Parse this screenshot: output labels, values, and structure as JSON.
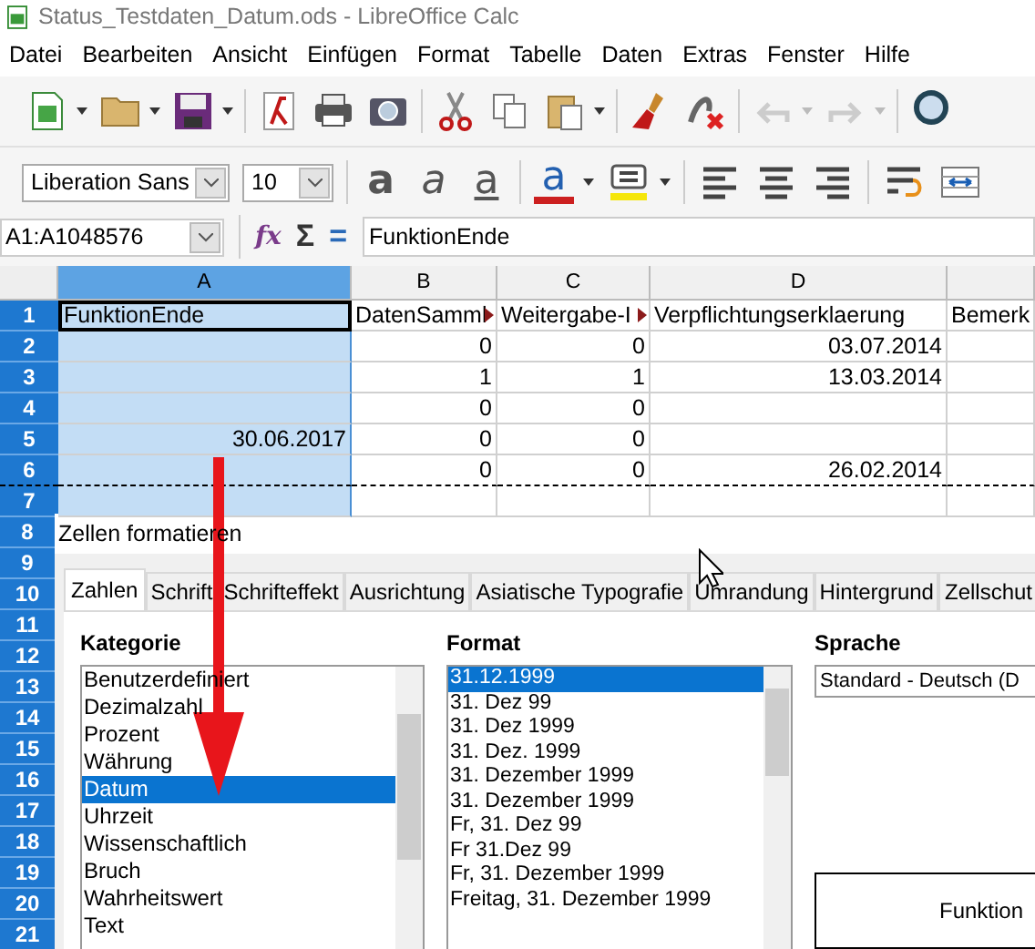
{
  "window": {
    "title": "Status_Testdaten_Datum.ods - LibreOffice Calc"
  },
  "menu": [
    "Datei",
    "Bearbeiten",
    "Ansicht",
    "Einfügen",
    "Format",
    "Tabelle",
    "Daten",
    "Extras",
    "Fenster",
    "Hilfe"
  ],
  "format_toolbar": {
    "font": "Liberation Sans",
    "size": "10",
    "glyphs": [
      {
        "kind": "bold",
        "glyph": "a"
      },
      {
        "kind": "italic",
        "glyph": "a"
      },
      {
        "kind": "underline",
        "glyph": "a"
      },
      {
        "kind": "font_color",
        "glyph": "a"
      }
    ]
  },
  "formula_bar": {
    "name_box": "A1:A1048576",
    "function_glyph": "fx",
    "sum_glyph": "Σ",
    "equals_glyph": "=",
    "content": "FunktionEnde"
  },
  "sheet": {
    "columns": [
      {
        "label": "A",
        "selected": true
      },
      {
        "label": "B",
        "selected": false
      },
      {
        "label": "C",
        "selected": false
      },
      {
        "label": "D",
        "selected": false
      }
    ],
    "rows": [
      {
        "label": "1",
        "kind": "text",
        "page_break": false,
        "cells": [
          "FunktionEnde",
          "DatenSamml",
          "Weitergabe-I",
          "Verpflichtungserklaerung",
          "Bemerk"
        ],
        "overflow": [
          false,
          true,
          true,
          false,
          false
        ]
      },
      {
        "label": "2",
        "kind": "number",
        "page_break": false,
        "cells": [
          null,
          "0",
          "0",
          "03.07.2014",
          null
        ],
        "overflow": [
          false,
          false,
          false,
          false,
          false
        ]
      },
      {
        "label": "3",
        "kind": "number",
        "page_break": false,
        "cells": [
          null,
          "1",
          "1",
          "13.03.2014",
          null
        ],
        "overflow": [
          false,
          false,
          false,
          false,
          false
        ]
      },
      {
        "label": "4",
        "kind": "number",
        "page_break": false,
        "cells": [
          null,
          "0",
          "0",
          null,
          null
        ],
        "overflow": [
          false,
          false,
          false,
          false,
          false
        ]
      },
      {
        "label": "5",
        "kind": "number",
        "page_break": false,
        "cells": [
          "30.06.2017",
          "0",
          "0",
          null,
          null
        ],
        "overflow": [
          false,
          false,
          false,
          false,
          false
        ]
      },
      {
        "label": "6",
        "kind": "number",
        "page_break": true,
        "cells": [
          null,
          "0",
          "0",
          "26.02.2014",
          null
        ],
        "overflow": [
          false,
          false,
          false,
          false,
          false
        ]
      },
      {
        "label": "7",
        "kind": "number",
        "page_break": false,
        "cells": [
          null,
          null,
          null,
          null,
          null
        ],
        "overflow": [
          false,
          false,
          false,
          false,
          false
        ]
      }
    ],
    "hidden_row_labels": [
      "8",
      "9",
      "10",
      "11",
      "12",
      "13",
      "14",
      "15",
      "16",
      "17",
      "18",
      "19",
      "20",
      "21"
    ]
  },
  "dialog": {
    "title": "Zellen formatieren",
    "tabs": [
      {
        "label": "Zahlen",
        "selected": true
      },
      {
        "label": "Schrift",
        "selected": false
      },
      {
        "label": "Schrifteffekt",
        "selected": false
      },
      {
        "label": "Ausrichtung",
        "selected": false
      },
      {
        "label": "Asiatische Typografie",
        "selected": false
      },
      {
        "label": "Umrandung",
        "selected": false
      },
      {
        "label": "Hintergrund",
        "selected": false
      },
      {
        "label": "Zellschut",
        "selected": false
      }
    ],
    "category": {
      "label": "Kategorie",
      "items": [
        {
          "label": "Benutzerdefiniert",
          "selected": false
        },
        {
          "label": "Dezimalzahl",
          "selected": false
        },
        {
          "label": "Prozent",
          "selected": false
        },
        {
          "label": "Währung",
          "selected": false
        },
        {
          "label": "Datum",
          "selected": true
        },
        {
          "label": "Uhrzeit",
          "selected": false
        },
        {
          "label": "Wissenschaftlich",
          "selected": false
        },
        {
          "label": "Bruch",
          "selected": false
        },
        {
          "label": "Wahrheitswert",
          "selected": false
        },
        {
          "label": "Text",
          "selected": false
        }
      ]
    },
    "format": {
      "label": "Format",
      "items": [
        {
          "label": "31.12.1999",
          "selected": true
        },
        {
          "label": "31. Dez 99",
          "selected": false
        },
        {
          "label": "31. Dez 1999",
          "selected": false
        },
        {
          "label": "31. Dez. 1999",
          "selected": false
        },
        {
          "label": "31. Dezember 1999",
          "selected": false
        },
        {
          "label": "31. Dezember 1999",
          "selected": false
        },
        {
          "label": "Fr, 31. Dez 99",
          "selected": false
        },
        {
          "label": "Fr 31.Dez 99",
          "selected": false
        },
        {
          "label": "Fr, 31. Dezember 1999",
          "selected": false
        },
        {
          "label": "Freitag, 31. Dezember 1999",
          "selected": false
        }
      ]
    },
    "language": {
      "label": "Sprache",
      "value": "Standard - Deutsch (D"
    },
    "preview": "Funktion"
  }
}
